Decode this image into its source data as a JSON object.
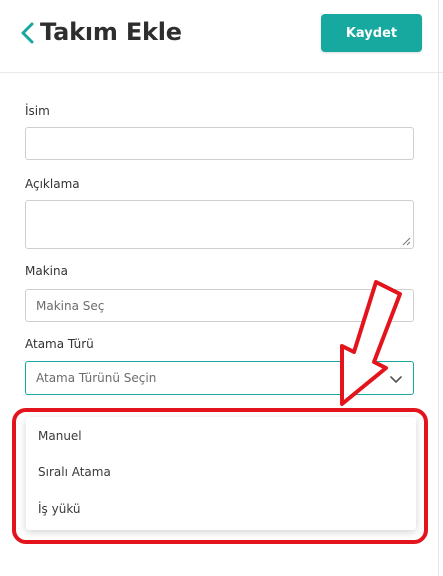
{
  "header": {
    "title": "Takım Ekle",
    "save_label": "Kaydet"
  },
  "form": {
    "name_label": "İsim",
    "description_label": "Açıklama",
    "machine_label": "Makina",
    "machine_placeholder": "Makina Seç",
    "assignment_label": "Atama Türü",
    "assignment_placeholder": "Atama Türünü Seçin"
  },
  "dropdown": {
    "options": [
      "Manuel",
      "Sıralı Atama",
      "İş yükü"
    ]
  },
  "colors": {
    "accent": "#17a8a0",
    "annotation": "#e3141b"
  },
  "icons": {
    "back": "chevron-left-icon",
    "select": "chevron-down-icon"
  }
}
